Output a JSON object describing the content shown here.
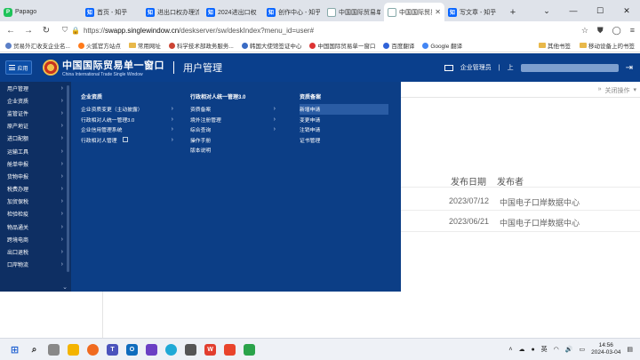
{
  "browser": {
    "tabs": [
      {
        "label": "Papago",
        "icon": "papago-icon",
        "active": false
      },
      {
        "label": "首页 - 知乎",
        "icon": "zhihu-icon",
        "active": false
      },
      {
        "label": "进出口权办理流",
        "icon": "zhihu-icon",
        "active": false
      },
      {
        "label": "2024进出口权",
        "icon": "zhihu-icon",
        "active": false
      },
      {
        "label": "创作中心 - 知乎",
        "icon": "zhihu-icon",
        "active": false
      },
      {
        "label": "中国国际贸易单",
        "icon": "single-window-icon",
        "active": false
      },
      {
        "label": "中国国际贸易单",
        "icon": "single-window-icon",
        "active": true
      },
      {
        "label": "写文章 - 知乎",
        "icon": "zhihu-icon",
        "active": false
      }
    ],
    "new_tab": "+",
    "url": "https://swapp.singlewindow.cn/deskserver/sw/deskIndex?menu_id=user#",
    "url_host": "swapp.singlewindow.cn",
    "url_pre": "https://",
    "url_post": "/deskserver/sw/deskIndex?menu_id=user#"
  },
  "bookmarks": {
    "items": [
      {
        "label": "贸易外汇收支企业名..."
      },
      {
        "label": "火狐官方站点"
      },
      {
        "label": "常用网址"
      },
      {
        "label": "科学技术部政务服务..."
      },
      {
        "label": "韩国大使馆签证中心"
      },
      {
        "label": "中国国际贸易单一窗口"
      },
      {
        "label": "百度翻译"
      },
      {
        "label": "Google 翻译"
      }
    ],
    "other": "其他书签",
    "mobile": "移动设备上的书签"
  },
  "header": {
    "menu_label": "应用",
    "logo_cn": "中国国际贸易单一窗口",
    "logo_en": "China International Trade Single Window",
    "title": "用户管理",
    "user_label": "企业管理员",
    "user_prefix": "上"
  },
  "sidebar": {
    "items": [
      "用户管理",
      "企业资质",
      "监管证件",
      "原产地证",
      "进口配额",
      "运输工具",
      "舱单申报",
      "货物申报",
      "税费办理",
      "加贸保税",
      "检验检疫",
      "物品通关",
      "跨境电商",
      "出口退税",
      "口岸物流"
    ]
  },
  "mega": {
    "columns": [
      {
        "title": "企业资质",
        "items": [
          {
            "label": "企业资质变更（主动披露）",
            "arrow": true
          },
          {
            "label": "行政相对人统一管理3.0",
            "arrow": true
          },
          {
            "label": "企业信用管理系统",
            "arrow": true
          },
          {
            "label": "行政相对人管理",
            "arrow": true,
            "icon": true
          }
        ]
      },
      {
        "title": "行政相对人统一管理3.0",
        "items": [
          {
            "label": "资质备案",
            "arrow": true
          },
          {
            "label": "境外注册管理",
            "arrow": true
          },
          {
            "label": "综合查询",
            "arrow": true
          },
          {
            "label": "操作手册",
            "arrow": false
          },
          {
            "label": "版本说明",
            "arrow": false
          }
        ]
      },
      {
        "title": "资质备案",
        "items": [
          {
            "label": "新增申请",
            "highlight": true
          },
          {
            "label": "变更申请",
            "highlight": false
          },
          {
            "label": "注销申请",
            "highlight": false
          },
          {
            "label": "证书管理",
            "highlight": false
          }
        ]
      }
    ]
  },
  "main": {
    "close_ops": "关闭操作",
    "columns": {
      "date": "发布日期",
      "publisher": "发布者"
    },
    "rows": [
      {
        "date": "2023/07/12",
        "publisher": "中国电子口岸数据中心"
      },
      {
        "date": "2023/06/21",
        "publisher": "中国电子口岸数据中心"
      }
    ]
  },
  "taskbar": {
    "ime": "英",
    "time": "14:56",
    "date": "2024-03-04"
  },
  "colors": {
    "header_blue": "#0a3f8c",
    "sidebar_navy": "#0e2f63",
    "mega_blue": "#0c3e86",
    "highlight": "#2a5ca4"
  }
}
